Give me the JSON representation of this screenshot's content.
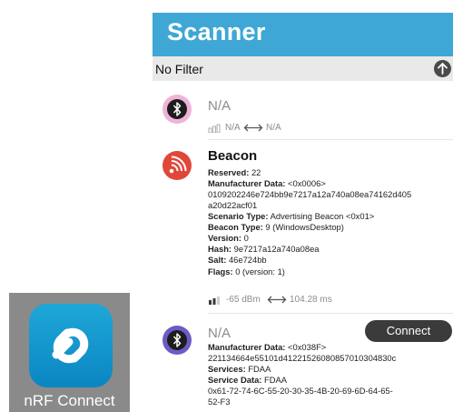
{
  "app": {
    "name": "nRF Connect"
  },
  "header": {
    "title": "Scanner"
  },
  "filter": {
    "label": "No Filter"
  },
  "devices": [
    {
      "name": "N/A",
      "signal_text": "N/A",
      "interval_text": "N/A",
      "icon": "bluetooth-icon",
      "icon_color": "#e9a6d0"
    },
    {
      "name": "Beacon",
      "icon": "beacon-icon",
      "icon_color": "#e0473a",
      "reserved_label": "Reserved:",
      "reserved_value": "22",
      "mfr_label": "Manufacturer Data:",
      "mfr_value_1": "<0x0006>",
      "mfr_value_2": "0109202246e724bb9e7217a12a740a08ea74162d405",
      "mfr_value_3": "a20d22acf01",
      "scenario_label": "Scenario Type:",
      "scenario_value": "Advertising Beacon <0x01>",
      "beacon_type_label": "Beacon Type:",
      "beacon_type_value": "9 (WindowsDesktop)",
      "version_label": "Version:",
      "version_value": "0",
      "hash_label": "Hash:",
      "hash_value": "9e7217a12a740a08ea",
      "salt_label": "Salt:",
      "salt_value": "46e724bb",
      "flags_label": "Flags:",
      "flags_value": "0 (version: 1)",
      "signal_text": "-65 dBm",
      "interval_text": "104.28 ms"
    },
    {
      "name": "N/A",
      "icon": "bluetooth-icon",
      "icon_color": "#6b5bc7",
      "connect_label": "Connect",
      "mfr_label": "Manufacturer Data:",
      "mfr_value_1": "<0x038F>",
      "mfr_value_2": "221134664e55101d41221526080857010304830c",
      "services_label": "Services:",
      "services_value": "FDAA",
      "service_data_label": "Service Data:",
      "service_data_value": "FDAA",
      "service_data_value_2": "0x61-72-74-6C-55-20-30-35-4B-20-69-6D-64-65-",
      "service_data_value_3": "52-F3"
    }
  ]
}
